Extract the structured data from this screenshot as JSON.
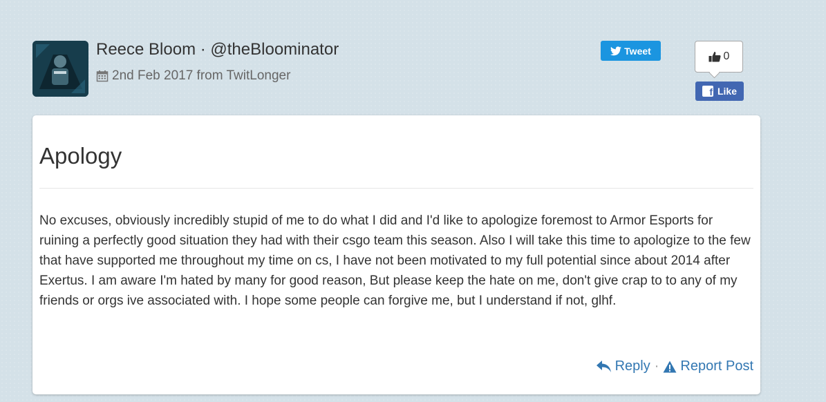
{
  "post": {
    "author": "Reece Bloom · @theBloominator",
    "date": "2nd Feb 2017 from TwitLonger",
    "title": "Apology",
    "body": "No excuses, obviously incredibly stupid of me to do what I did and I'd like to apologize foremost to Armor Esports for ruining a perfectly good situation they had with their csgo team this season. Also I will take this time to apologize to the few that have supported me throughout my time on cs, I have not been motivated to my full potential since about 2014 after Exertus. I am aware I'm hated by many for good reason, But please keep the hate on me, don't give crap to to any of my friends or orgs ive associated with. I hope some people can forgive me, but I understand if not, glhf."
  },
  "social": {
    "tweet_label": "Tweet",
    "like_count": "0",
    "fb_like_label": "Like"
  },
  "actions": {
    "reply_label": "Reply",
    "separator": "·",
    "report_label": "Report Post"
  },
  "icons": {
    "avatar": "user-avatar-image",
    "date": "calendar-icon",
    "tweet": "twitter-bird-icon",
    "like": "thumbs-up-icon",
    "fb": "facebook-icon",
    "reply": "reply-arrow-icon",
    "report": "warning-triangle-icon"
  },
  "colors": {
    "background": "#d4e1e8",
    "link": "#3277b2",
    "twitter": "#1b95e0",
    "facebook": "#4267b2"
  }
}
